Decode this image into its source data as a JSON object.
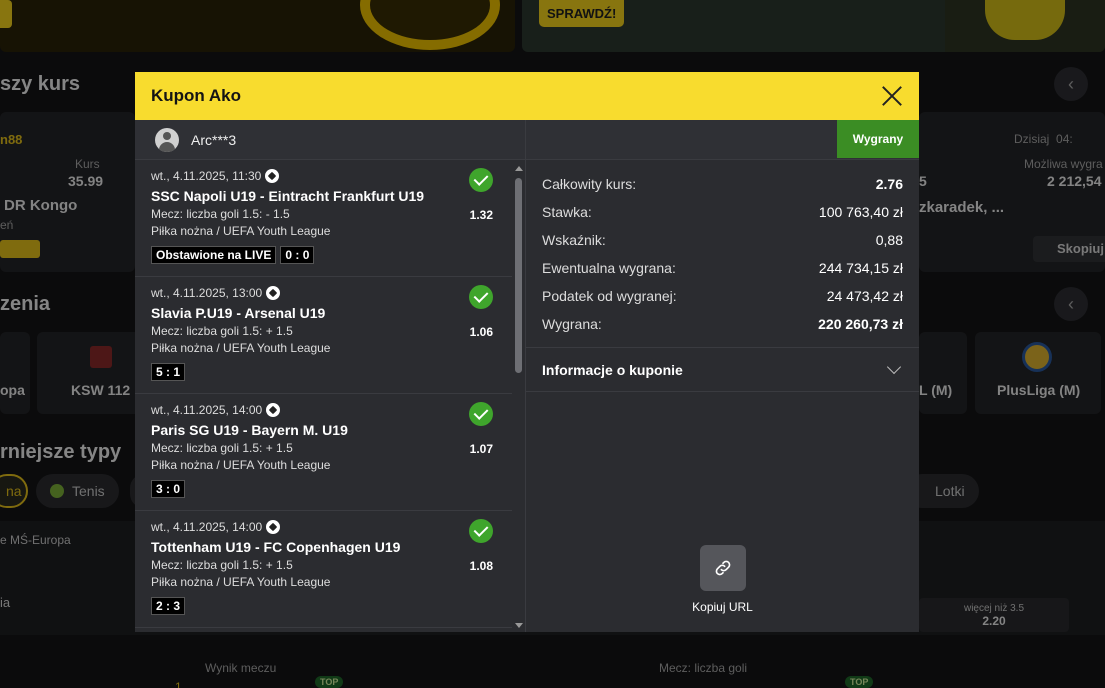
{
  "background": {
    "banner_button": "SPRAWDŹ!",
    "section1_title": "szy kurs",
    "card_left": {
      "user": "n88",
      "kurs_label": "Kurs",
      "kurs_value": "35.99",
      "team": "DR Kongo",
      "sub": "eń"
    },
    "card_right": {
      "date_label": "Dzisiaj",
      "time": "04:",
      "win_label": "Możliwa wygra",
      "win_value": "2 212,54",
      "partial_value": "5",
      "player": "zkaradek, ...",
      "copy": "Skopiuj"
    },
    "section2_title": "zenia",
    "tiles": [
      "opa",
      "KSW 112",
      "L (M)",
      "PlusLiga (M)"
    ],
    "section3_title": "rniejsze typy",
    "pills": [
      "na",
      "Tenis",
      "Lotki"
    ],
    "league": "e MŚ-Europa",
    "row_label": "ia",
    "odds_label": "więcej niż 3.5",
    "odds_value": "2.20",
    "wynik_label": "Wynik meczu",
    "mecz_label": "Mecz: liczba goli",
    "top": "TOP",
    "row_number": "1"
  },
  "modal": {
    "title": "Kupon Ako",
    "username": "Arc***3",
    "status": "Wygrany",
    "bets": [
      {
        "date": "wt., 4.11.2025, 11:30",
        "teams": "SSC Napoli U19 - Eintracht Frankfurt U19",
        "market": "Mecz: liczba goli 1.5: - 1.5",
        "odds": "1.32",
        "league": "Piłka nożna / UEFA Youth League",
        "live": "Obstawione na LIVE",
        "score": "0 : 0"
      },
      {
        "date": "wt., 4.11.2025, 13:00",
        "teams": "Slavia P.U19 - Arsenal U19",
        "market": "Mecz: liczba goli 1.5: + 1.5",
        "odds": "1.06",
        "league": "Piłka nożna / UEFA Youth League",
        "score": "5 : 1"
      },
      {
        "date": "wt., 4.11.2025, 14:00",
        "teams": "Paris SG U19 - Bayern M. U19",
        "market": "Mecz: liczba goli 1.5: + 1.5",
        "odds": "1.07",
        "league": "Piłka nożna / UEFA Youth League",
        "score": "3 : 0"
      },
      {
        "date": "wt., 4.11.2025, 14:00",
        "teams": "Tottenham U19 - FC Copenhagen U19",
        "market": "Mecz: liczba goli 1.5: + 1.5",
        "odds": "1.08",
        "league": "Piłka nożna / UEFA Youth League",
        "score": "2 : 3"
      }
    ],
    "summary": [
      {
        "label": "Całkowity kurs:",
        "value": "2.76"
      },
      {
        "label": "Stawka:",
        "value": "100 763,40 zł"
      },
      {
        "label": "Wskaźnik:",
        "value": "0,88"
      },
      {
        "label": "Ewentualna wygrana:",
        "value": "244 734,15 zł"
      },
      {
        "label": "Podatek od wygranej:",
        "value": "24 473,42 zł"
      },
      {
        "label": "Wygrana:",
        "value": "220 260,73 zł"
      }
    ],
    "info_label": "Informacje o kuponie",
    "copy_label": "Kopiuj URL"
  }
}
